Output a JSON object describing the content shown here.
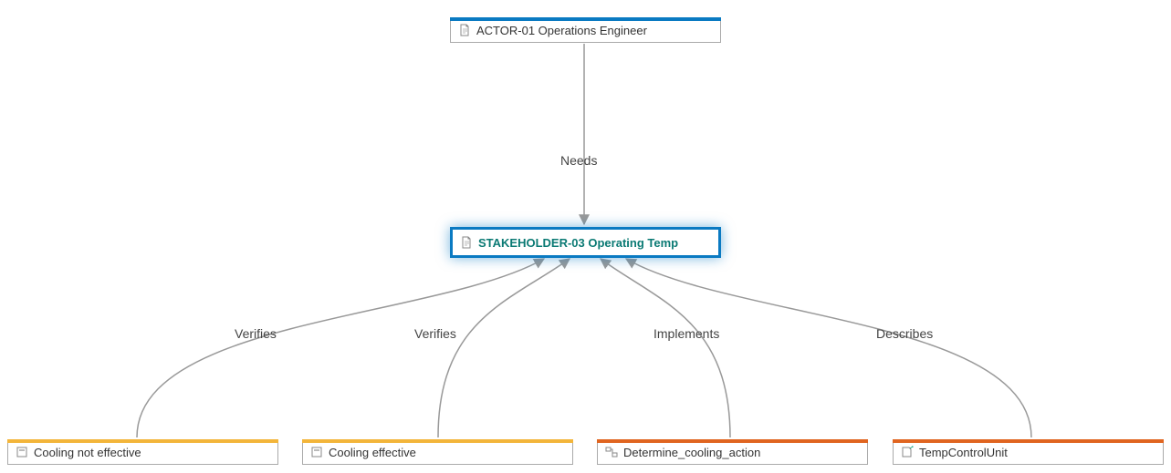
{
  "nodes": {
    "actor": {
      "label": "ACTOR-01 Operations Engineer"
    },
    "stakeholder": {
      "label": "STAKEHOLDER-03 Operating Temp"
    },
    "coolingNot": {
      "label": "Cooling not effective"
    },
    "coolingEff": {
      "label": "Cooling effective"
    },
    "determine": {
      "label": "Determine_cooling_action"
    },
    "tempCtl": {
      "label": "TempControlUnit"
    }
  },
  "edges": {
    "needs": "Needs",
    "verifies1": "Verifies",
    "verifies2": "Verifies",
    "implements": "Implements",
    "describes": "Describes"
  }
}
